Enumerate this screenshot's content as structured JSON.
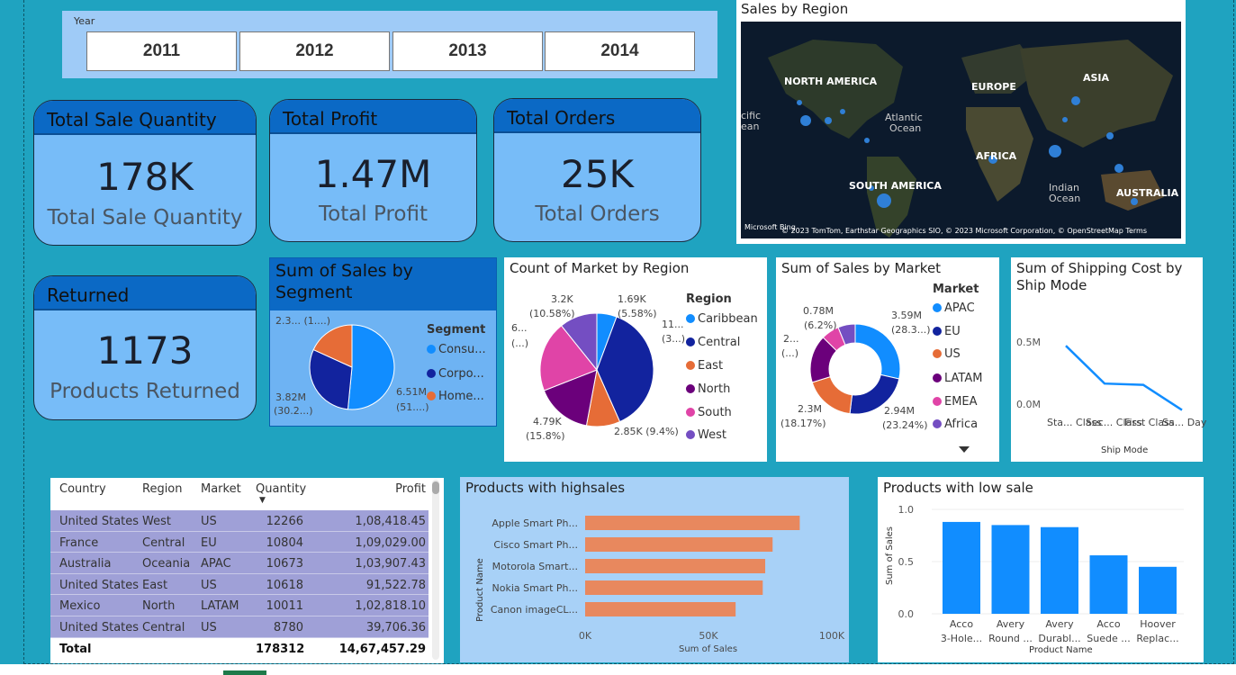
{
  "slicer": {
    "title": "Year",
    "years": [
      "2011",
      "2012",
      "2013",
      "2014"
    ]
  },
  "kpis": {
    "quantity": {
      "title": "Total Sale Quantity",
      "value": "178K",
      "label": "Total Sale Quantity"
    },
    "profit": {
      "title": "Total Profit",
      "value": "1.47M",
      "label": "Total Profit"
    },
    "orders": {
      "title": "Total Orders",
      "value": "25K",
      "label": "Total Orders"
    },
    "returned": {
      "title": "Returned",
      "value": "1173",
      "label": "Products Returned"
    }
  },
  "map": {
    "title": "Sales by Region",
    "labels": {
      "na": "NORTH AMERICA",
      "eu": "EUROPE",
      "asia": "ASIA",
      "atl": "Atlantic",
      "atl2": "Ocean",
      "pac": "cific",
      "pac2": "ean",
      "af": "AFRICA",
      "sa": "SOUTH AMERICA",
      "ind": "Indian",
      "ind2": "Ocean",
      "au": "AUSTRALIA"
    },
    "credit": "© 2023 TomTom, Earthstar Geographics SIO, © 2023 Microsoft Corporation, © OpenStreetMap  Terms",
    "brand": "Microsoft Bing"
  },
  "chart_data": [
    {
      "type": "pie",
      "title": "Sum of Sales by Segment",
      "legend_title": "Segment",
      "categories": [
        "Consu...",
        "Corpo...",
        "Home..."
      ],
      "values": [
        6.51,
        3.82,
        2.3
      ],
      "colors": [
        "#118DFF",
        "#12239E",
        "#E66C37"
      ],
      "data_labels": [
        "6.51M",
        "(51....)",
        "3.82M",
        "(30.2...)",
        "2.3... (1....)"
      ]
    },
    {
      "type": "pie",
      "title": "Count of Market by Region",
      "legend_title": "Region",
      "categories": [
        "Caribbean",
        "Central",
        "East",
        "North",
        "South",
        "West"
      ],
      "values": [
        1.69,
        11.2,
        2.85,
        4.79,
        6.0,
        3.2
      ],
      "colors": [
        "#118DFF",
        "#12239E",
        "#E66C37",
        "#6B007B",
        "#E044A7",
        "#744EC2"
      ],
      "data_labels": [
        "1.69K",
        "(5.58%)",
        "11...",
        "(3...)",
        "2.85K (9.4%)",
        "4.79K",
        "(15.8%)",
        "6...",
        "(...)",
        "3.2K",
        "(10.58%)"
      ]
    },
    {
      "type": "pie",
      "title": "Sum of Sales by Market",
      "legend_title": "Market",
      "categories": [
        "APAC",
        "EU",
        "US",
        "LATAM",
        "EMEA",
        "Africa"
      ],
      "values": [
        3.59,
        2.94,
        2.3,
        2.16,
        0.81,
        0.78
      ],
      "colors": [
        "#118DFF",
        "#12239E",
        "#E66C37",
        "#6B007B",
        "#E044A7",
        "#744EC2"
      ],
      "data_labels": [
        "3.59M",
        "(28.3...)",
        "2.94M",
        "(23.24%)",
        "2.3M",
        "(18.17%)",
        "2...",
        "(...)",
        "0.78M",
        "(6.2%)"
      ]
    },
    {
      "type": "line",
      "title": "Sum of Shipping Cost by Ship Mode",
      "categories": [
        "Sta... Class",
        "Sec... Class",
        "First Class",
        "Sa... Day"
      ],
      "values": [
        0.62,
        0.32,
        0.31,
        0.11
      ],
      "xlabel": "Ship Mode",
      "yticks": [
        "0.5M",
        "0.0M"
      ],
      "color": "#118DFF"
    },
    {
      "type": "bar",
      "orientation": "horizontal",
      "title": "Products with highsales",
      "categories": [
        "Apple Smart Ph...",
        "Cisco Smart Ph...",
        "Motorola Smart...",
        "Nokia Smart Ph...",
        "Canon imageCL..."
      ],
      "values": [
        87000,
        76000,
        73000,
        72000,
        61000
      ],
      "xlabel": "Sum of Sales",
      "ylabel": "Product Name",
      "xticks": [
        "0K",
        "50K",
        "100K"
      ],
      "xlim": [
        0,
        100000
      ],
      "color": "#E8885E"
    },
    {
      "type": "bar",
      "title": "Products with low sale",
      "categories": [
        "Acco 3-Hole...",
        "Avery Round ...",
        "Avery Durabl...",
        "Acco Suede ...",
        "Hoover Replac..."
      ],
      "values": [
        0.88,
        0.85,
        0.83,
        0.56,
        0.45
      ],
      "xlabel": "Product Name",
      "ylabel": "Sum of Sales",
      "yticks": [
        "1.0",
        "0.5",
        "0.0"
      ],
      "ylim": [
        0,
        1.0
      ],
      "color": "#118DFF"
    }
  ],
  "table": {
    "headers": [
      "Country",
      "Region",
      "Market",
      "Quantity",
      "Profit"
    ],
    "rows": [
      [
        "United States",
        "West",
        "US",
        "12266",
        "1,08,418.45"
      ],
      [
        "France",
        "Central",
        "EU",
        "10804",
        "1,09,029.00"
      ],
      [
        "Australia",
        "Oceania",
        "APAC",
        "10673",
        "1,03,907.43"
      ],
      [
        "United States",
        "East",
        "US",
        "10618",
        "91,522.78"
      ],
      [
        "Mexico",
        "North",
        "LATAM",
        "10011",
        "1,02,818.10"
      ],
      [
        "United States",
        "Central",
        "US",
        "8780",
        "39,706.36"
      ]
    ],
    "total": [
      "Total",
      "",
      "",
      "178312",
      "14,67,457.29"
    ]
  }
}
